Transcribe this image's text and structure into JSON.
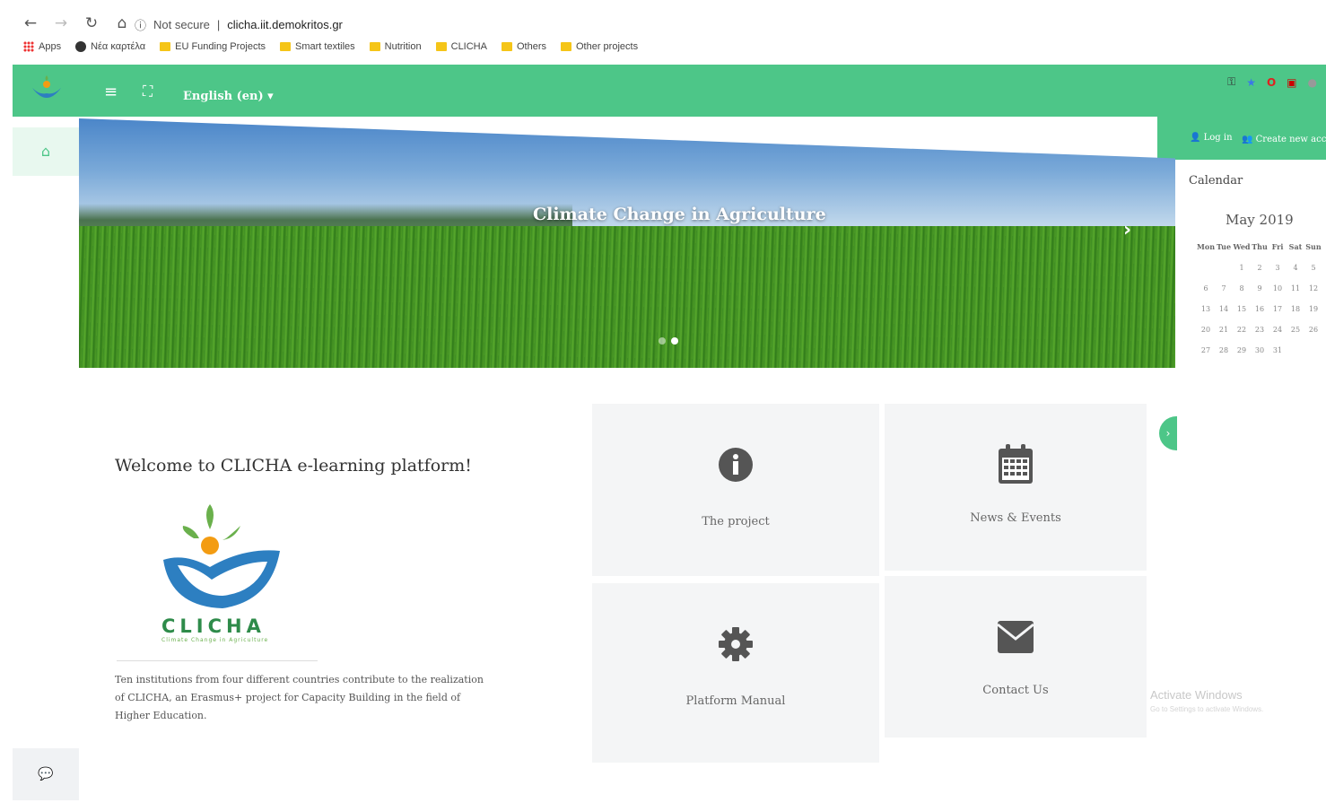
{
  "browser": {
    "security": "Not secure",
    "url": "clicha.iit.demokritos.gr",
    "bookmarks": [
      "Apps",
      "Νέα καρτέλα",
      "EU Funding Projects",
      "Smart textiles",
      "Nutrition",
      "CLICHA",
      "Others",
      "Other projects"
    ]
  },
  "header": {
    "language": "English (en)",
    "login": "Log in",
    "create_account": "Create new account"
  },
  "banner": {
    "title": "Climate Change in Agriculture"
  },
  "calendar": {
    "title": "Calendar",
    "month": "May 2019",
    "weekdays": [
      "Mon",
      "Tue",
      "Wed",
      "Thu",
      "Fri",
      "Sat",
      "Sun"
    ],
    "days": [
      "",
      "",
      "1",
      "2",
      "3",
      "4",
      "5",
      "6",
      "7",
      "8",
      "9",
      "10",
      "11",
      "12",
      "13",
      "14",
      "15",
      "16",
      "17",
      "18",
      "19",
      "20",
      "21",
      "22",
      "23",
      "24",
      "25",
      "26",
      "27",
      "28",
      "29",
      "30",
      "31"
    ]
  },
  "main": {
    "welcome": "Welcome to CLICHA e-learning platform!",
    "logo_text": "CLICHA",
    "logo_sub": "Climate Change in Agriculture",
    "description": "Ten institutions from four different countries contribute to the realization of CLICHA, an Erasmus+ project for Capacity Building in the field of Higher Education."
  },
  "tiles": {
    "project": "The project",
    "news": "News & Events",
    "manual": "Platform Manual",
    "contact": "Contact Us"
  },
  "watermark": {
    "line1": "Activate Windows",
    "line2": "Go to Settings to activate Windows."
  },
  "colors": {
    "brand_green": "#4dc688"
  }
}
